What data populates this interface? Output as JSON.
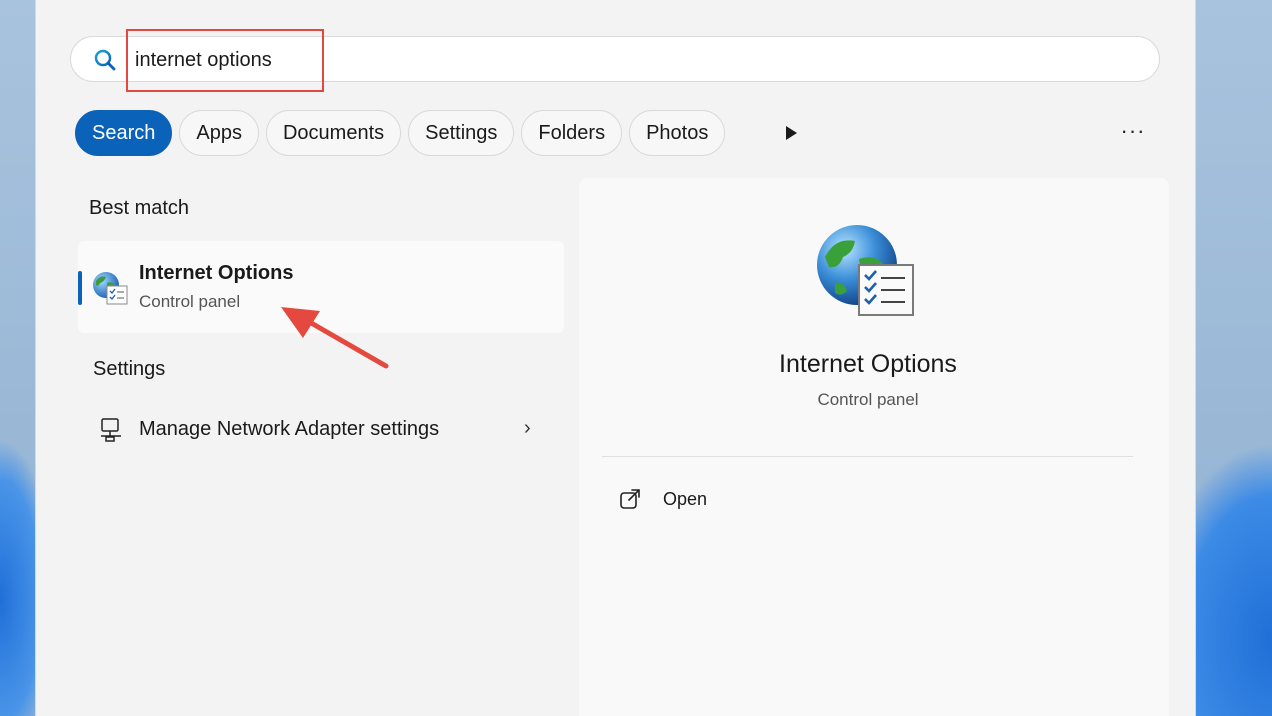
{
  "search": {
    "query": "internet options"
  },
  "filters": [
    {
      "label": "Search",
      "active": true
    },
    {
      "label": "Apps",
      "active": false
    },
    {
      "label": "Documents",
      "active": false
    },
    {
      "label": "Settings",
      "active": false
    },
    {
      "label": "Folders",
      "active": false
    },
    {
      "label": "Photos",
      "active": false
    }
  ],
  "more_label": "···",
  "best_match": {
    "heading": "Best match",
    "item": {
      "title": "Internet Options",
      "subtitle": "Control panel",
      "icon": "internet-options-icon"
    }
  },
  "settings_section": {
    "heading": "Settings",
    "items": [
      {
        "label": "Manage Network Adapter settings",
        "icon": "network-adapter-icon"
      }
    ]
  },
  "preview": {
    "title": "Internet Options",
    "subtitle": "Control panel",
    "actions": [
      {
        "label": "Open",
        "icon": "open-external-icon"
      }
    ]
  },
  "colors": {
    "accent": "#0a63b9",
    "annotation": "#e5483e"
  }
}
